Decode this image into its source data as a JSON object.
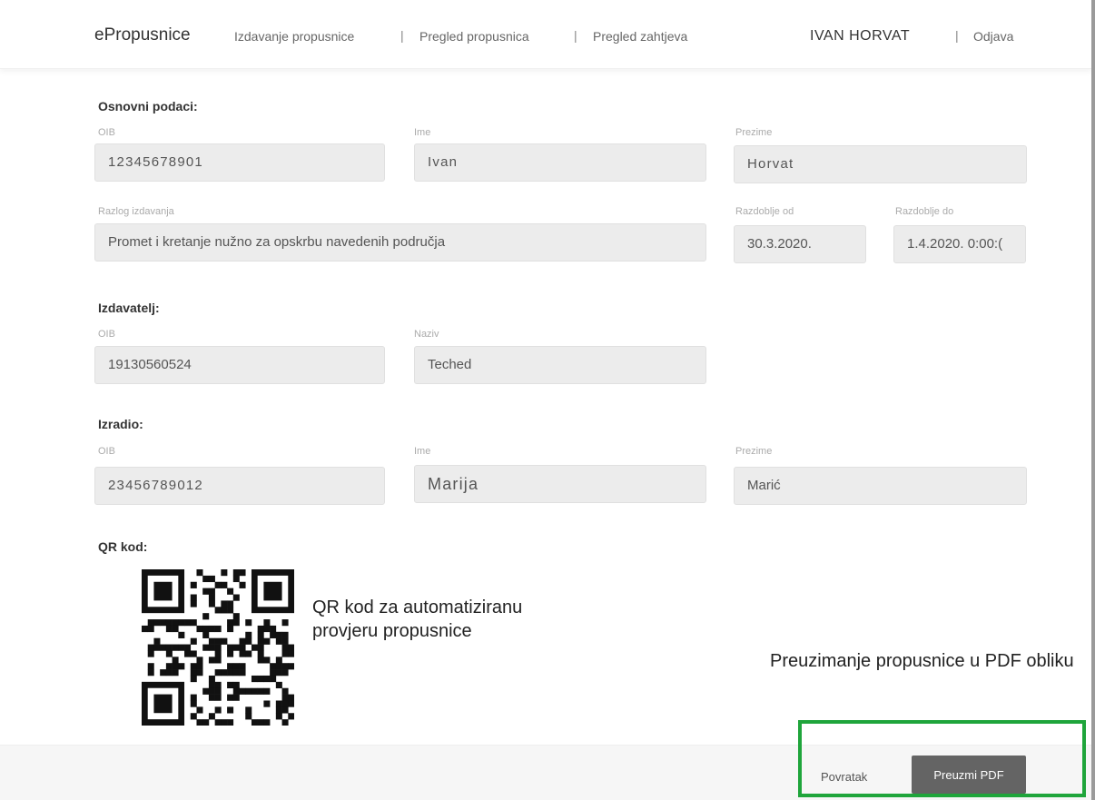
{
  "navbar": {
    "brand": "ePropusnice",
    "links": [
      "Izdavanje propusnice",
      "Pregled propusnica",
      "Pregled zahtjeva"
    ],
    "separator": "|",
    "user": "IVAN HORVAT",
    "logout": "Odjava"
  },
  "basic": {
    "title": "Osnovni podaci:",
    "oib_label": "OIB",
    "oib": "12345678901",
    "ime_label": "Ime",
    "ime": "Ivan",
    "prezime_label": "Prezime",
    "prezime": "Horvat",
    "razlog_label": "Razlog izdavanja",
    "razlog": "Promet i kretanje nužno za opskrbu navedenih područja",
    "od_label": "Razdoblje od",
    "od": "30.3.2020.",
    "do_label": "Razdoblje do",
    "do": "1.4.2020. 0:00:("
  },
  "issuer": {
    "title": "Izdavatelj:",
    "oib_label": "OIB",
    "oib": "19130560524",
    "naziv_label": "Naziv",
    "naziv": "Teched"
  },
  "creator": {
    "title": "Izradio:",
    "oib_label": "OIB",
    "oib": "23456789012",
    "ime_label": "Ime",
    "ime": "Marija",
    "prezime_label": "Prezime",
    "prezime": "Marić"
  },
  "qr": {
    "title": "QR kod:",
    "note": "QR kod za automatiziranu provjeru propusnice"
  },
  "pdf_note": "Preuzimanje propusnice u PDF obliku",
  "footer": {
    "back": "Povratak",
    "download": "Preuzmi PDF"
  },
  "colors": {
    "highlight": "#1fa53b",
    "button": "#646464",
    "field_bg": "#ececec"
  }
}
